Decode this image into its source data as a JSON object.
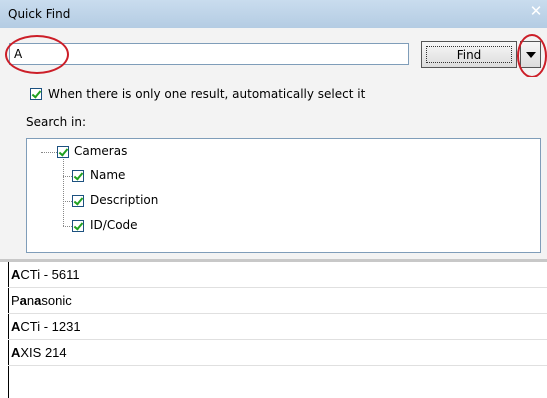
{
  "window": {
    "title": "Quick Find"
  },
  "search": {
    "value": "A",
    "find_label": "Find"
  },
  "options": {
    "auto_select_label": "When there is only one result, automatically select it",
    "auto_select_checked": true
  },
  "search_in": {
    "label": "Search in:",
    "root": {
      "label": "Cameras",
      "checked": true
    },
    "children": [
      {
        "label": "Name",
        "checked": true
      },
      {
        "label": "Description",
        "checked": true
      },
      {
        "label": "ID/Code",
        "checked": true
      }
    ]
  },
  "results": [
    {
      "match": "A",
      "rest": "CTi - 5611"
    },
    {
      "prefix": "P",
      "match": "a",
      "middle": "n",
      "match2": "a",
      "rest": "sonic"
    },
    {
      "match": "A",
      "rest": "CTi - 1231"
    },
    {
      "match": "A",
      "rest": "XIS 214"
    }
  ],
  "colors": {
    "highlight_ellipse": "#cc1e28",
    "titlebar": "#c9dcee"
  }
}
